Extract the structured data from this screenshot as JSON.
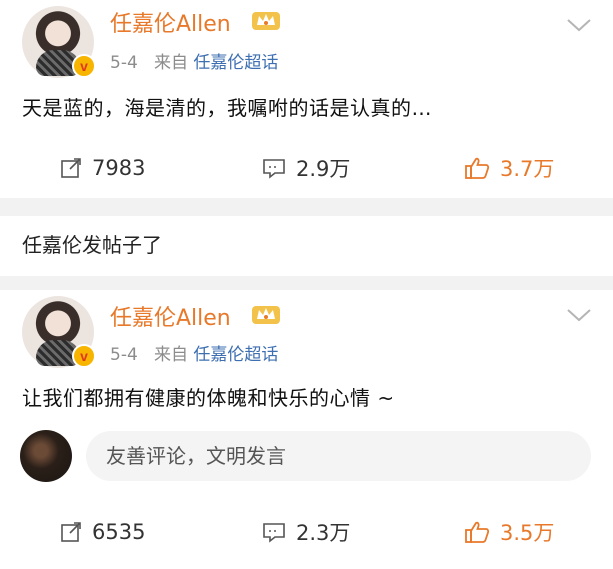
{
  "posts": [
    {
      "author": "任嘉伦Allen",
      "date": "5-4",
      "source_prefix": "来自",
      "source": "任嘉伦超话",
      "text": "天是蓝的，海是清的，我嘱咐的话是认真的…",
      "repost_count": "7983",
      "comment_count": "2.9万",
      "like_count": "3.7万"
    },
    {
      "author": "任嘉伦Allen",
      "date": "5-4",
      "source_prefix": "来自",
      "source": "任嘉伦超话",
      "text": "让我们都拥有健康的体魄和快乐的心情 ~",
      "comment_placeholder": "友善评论，文明发言",
      "repost_count": "6535",
      "comment_count": "2.3万",
      "like_count": "3.5万"
    }
  ],
  "section_note": "任嘉伦发帖子了",
  "colors": {
    "author_name": "#e8792a",
    "source_link": "#3d6fb1",
    "like_active": "#e8792a",
    "meta": "#8c8c8c"
  },
  "icons": [
    "crown-badge-icon",
    "verified-badge-icon",
    "chevron-down-icon",
    "repost-icon",
    "comment-icon",
    "like-icon"
  ]
}
